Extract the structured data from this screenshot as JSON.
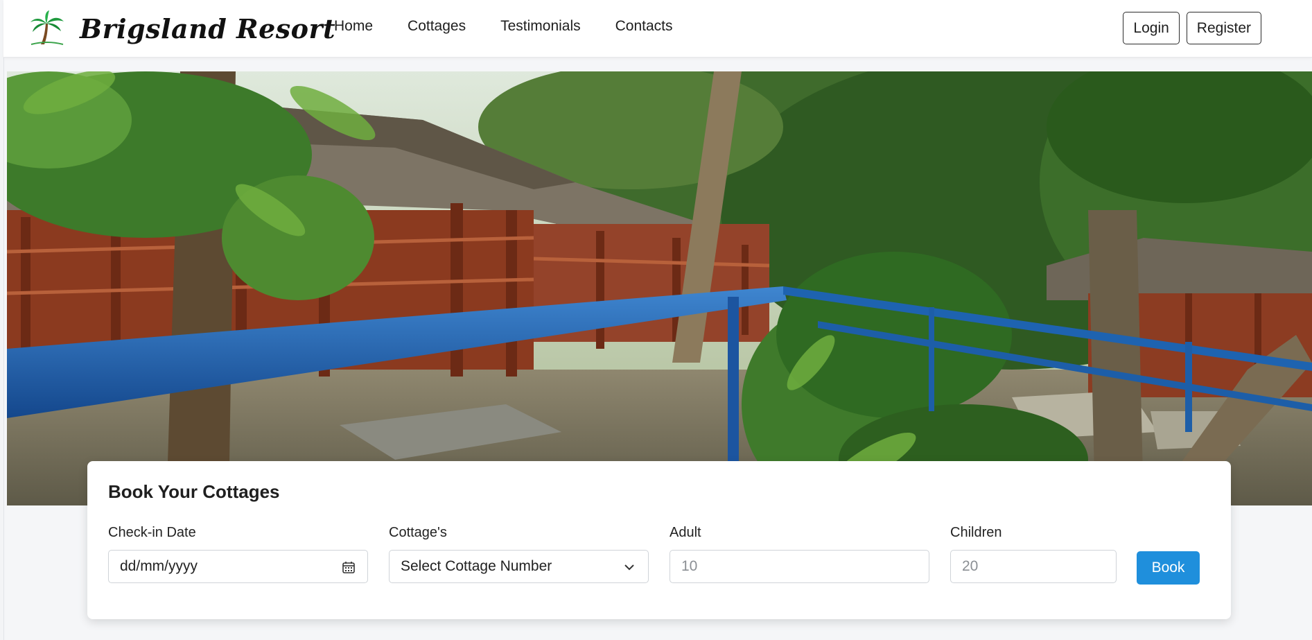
{
  "header": {
    "brand_name": "Brigsland Resort",
    "logo_icon": "palm-tree-icon",
    "nav": [
      {
        "label": "Home"
      },
      {
        "label": "Cottages"
      },
      {
        "label": "Testimonials"
      },
      {
        "label": "Contacts"
      }
    ],
    "login_label": "Login",
    "register_label": "Register"
  },
  "hero": {
    "image_description_icon": "resort-cottages-photo"
  },
  "booking": {
    "title": "Book Your Cottages",
    "checkin": {
      "label": "Check-in Date",
      "value": "dd/mm/yyyy",
      "icon": "calendar-icon"
    },
    "cottage": {
      "label": "Cottage's",
      "selected": "Select Cottage Number",
      "icon": "chevron-down-icon"
    },
    "adult": {
      "label": "Adult",
      "placeholder": "10"
    },
    "children": {
      "label": "Children",
      "placeholder": "20"
    },
    "book_label": "Book"
  },
  "colors": {
    "accent": "#1f8fdc",
    "rail_blue": "#1e63b0",
    "wood": "#8b3a1f"
  }
}
